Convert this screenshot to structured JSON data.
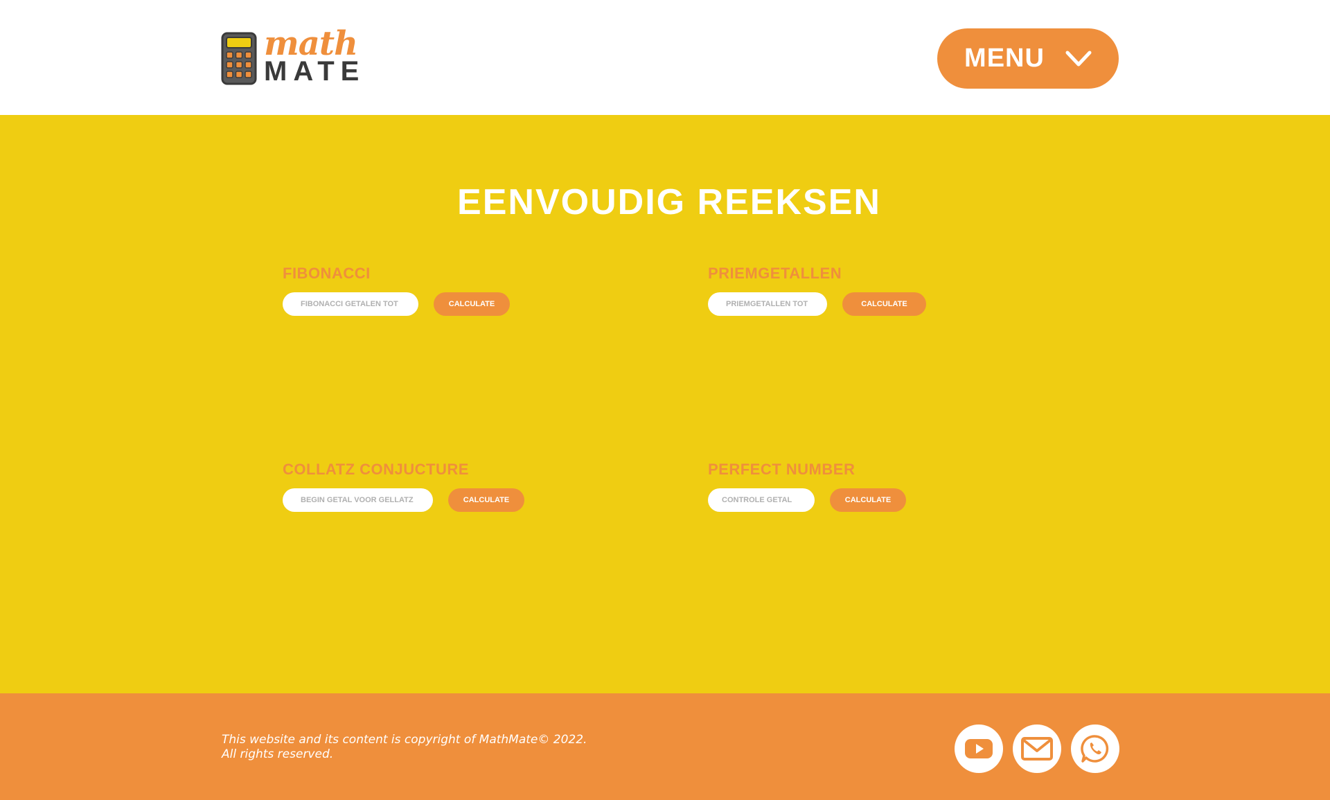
{
  "header": {
    "logo": {
      "line1": "math",
      "line2": "MATE"
    },
    "menu": {
      "label": "MENU"
    }
  },
  "main": {
    "title": "EENVOUDIG REEKSEN",
    "cards": [
      {
        "title": "FIBONACCI",
        "placeholder": "FIBONACCI GETALEN TOT",
        "button": "CALCULATE"
      },
      {
        "title": "PRIEMGETALLEN",
        "placeholder": "PRIEMGETALLEN TOT",
        "button": "CALCULATE"
      },
      {
        "title": "COLLATZ CONJUCTURE",
        "placeholder": "BEGIN GETAL VOOR GELLATZ",
        "button": "CALCULATE"
      },
      {
        "title": "PERFECT NUMBER",
        "placeholder": "CONTROLE GETAL",
        "button": "CALCULATE"
      }
    ]
  },
  "footer": {
    "copyright_line1": "This website and its content is copyright of MathMate© 2022.",
    "copyright_line2": "All rights reserved.",
    "social": [
      {
        "icon": "youtube-icon"
      },
      {
        "icon": "mail-icon"
      },
      {
        "icon": "whatsapp-icon"
      }
    ]
  },
  "colors": {
    "accent_orange": "#EF8F3C",
    "background_yellow": "#EFCD12",
    "logo_dark": "#3A3A3A",
    "white": "#FFFFFF"
  }
}
